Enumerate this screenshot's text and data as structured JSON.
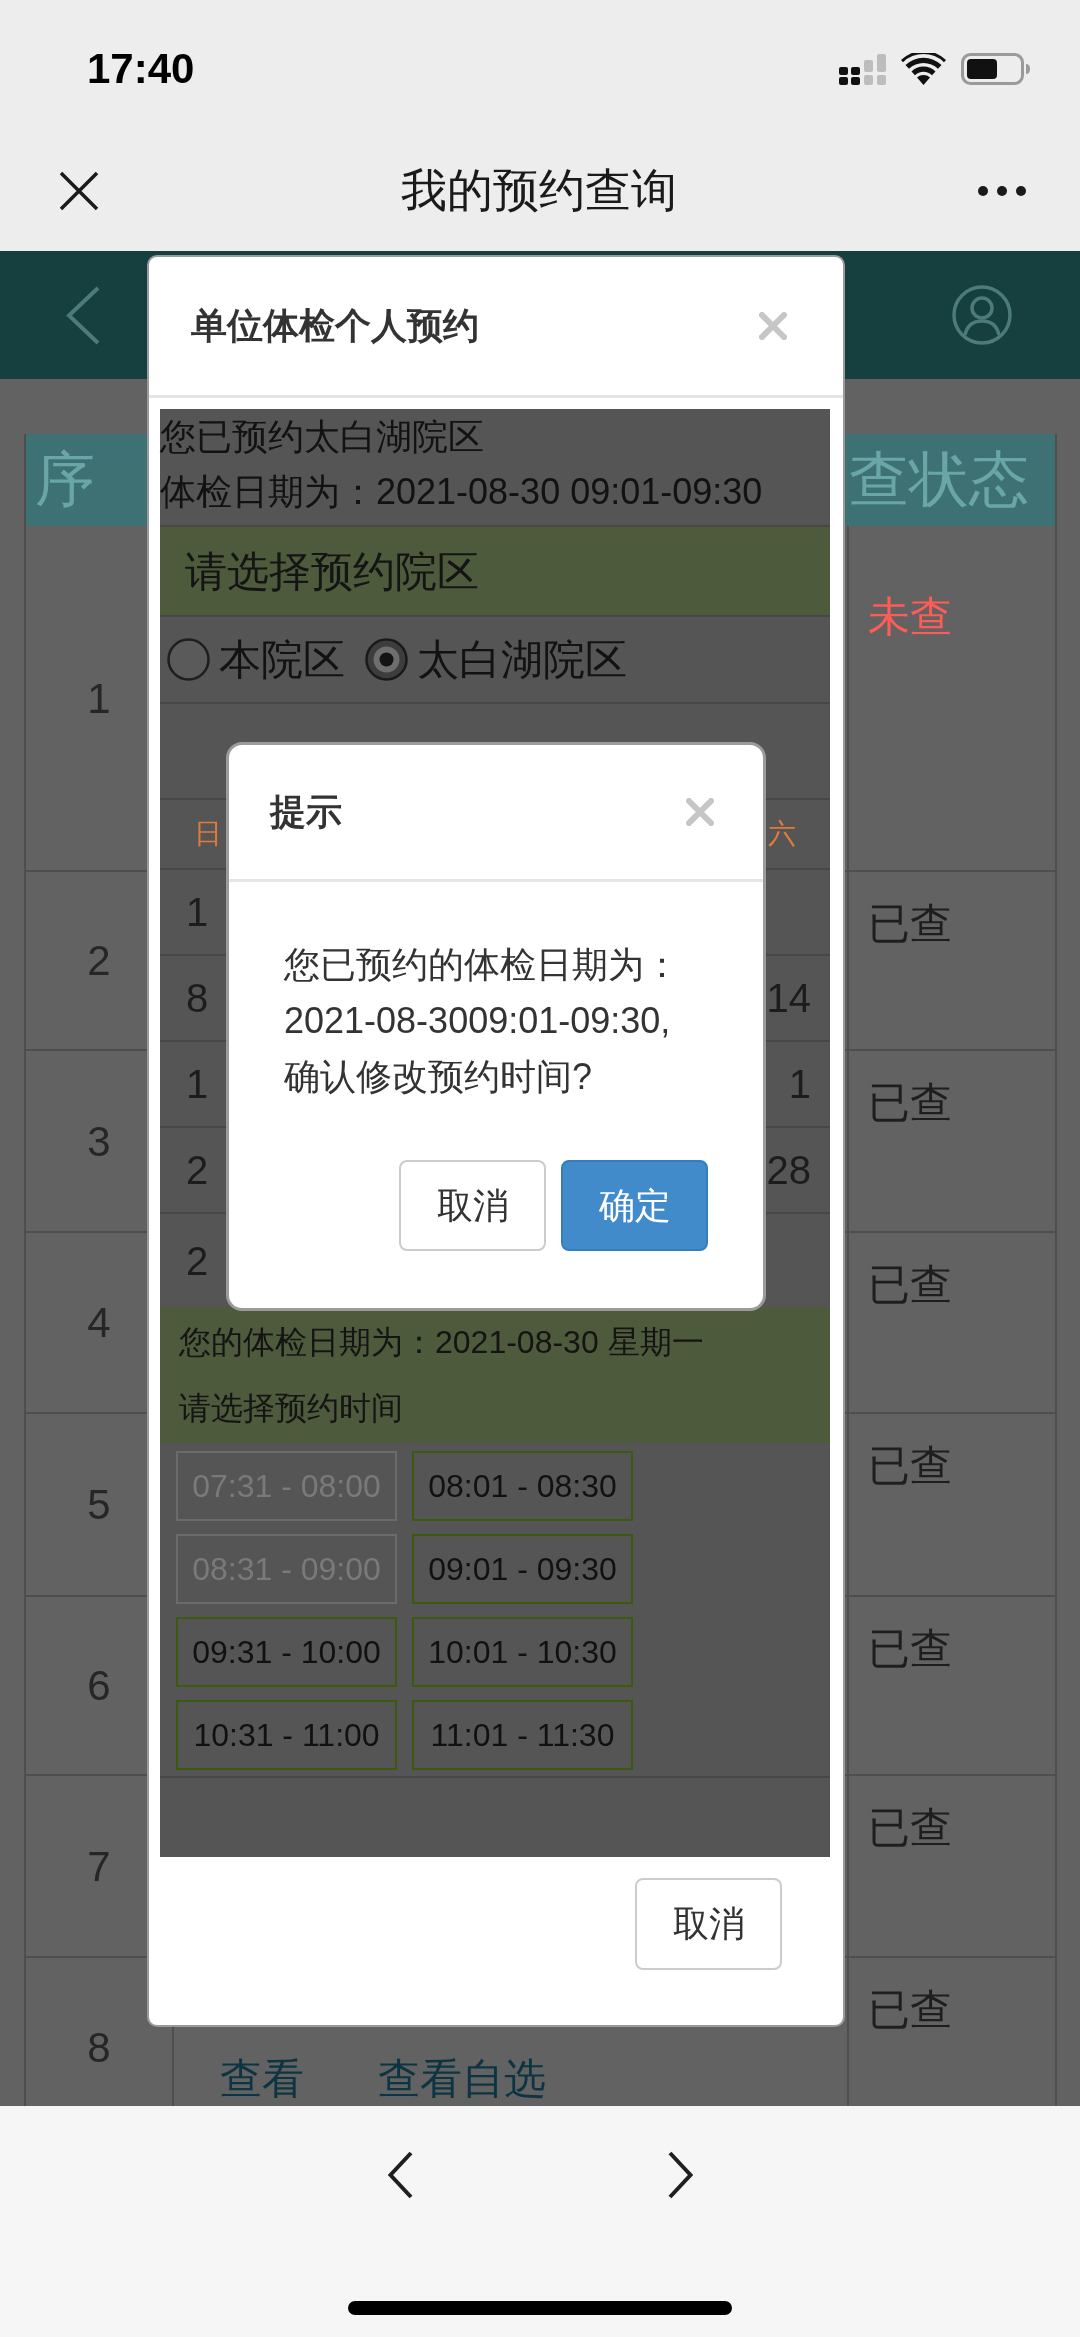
{
  "status_bar": {
    "time": "17:40"
  },
  "nav_bar": {
    "title": "我的预约查询"
  },
  "table": {
    "columns": [
      {
        "label": "序"
      },
      {
        "label": "查状态"
      }
    ],
    "rows": [
      {
        "number": "1",
        "status": "未查",
        "checked": false
      },
      {
        "number": "2",
        "status": "已查",
        "checked": true
      },
      {
        "number": "3",
        "status": "已查",
        "checked": true
      },
      {
        "number": "4",
        "status": "已查",
        "checked": true
      },
      {
        "number": "5",
        "status": "已查",
        "checked": true
      },
      {
        "number": "6",
        "status": "已查",
        "checked": true
      },
      {
        "number": "7",
        "status": "已查",
        "checked": true
      },
      {
        "number": "8",
        "status": "已查",
        "checked": true,
        "links": [
          "查看",
          "查看自选"
        ]
      }
    ]
  },
  "booking_dialog": {
    "title": "单位体检个人预约",
    "booked_campus": "您已预约太白湖院区",
    "booked_date": "体检日期为：2021-08-30 09:01-09:30",
    "campus_prompt": "请选择预约院区",
    "campuses": [
      {
        "label": "本院区",
        "selected": false
      },
      {
        "label": "太白湖院区",
        "selected": true
      }
    ],
    "calendar": {
      "weekdays": {
        "sunday": "日",
        "saturday": "六"
      },
      "weeks": [
        {
          "sunday": "1"
        },
        {
          "sunday": "8",
          "saturday": "14"
        },
        {
          "sunday": "1",
          "saturday": "1"
        },
        {
          "sunday": "2",
          "saturday": "28"
        },
        {
          "sunday": "2"
        }
      ]
    },
    "selected_date": "您的体检日期为：2021-08-30 星期一",
    "time_prompt": "请选择预约时间",
    "time_slots": [
      {
        "label": "07:31 - 08:00",
        "disabled": true
      },
      {
        "label": "08:01 - 08:30",
        "disabled": false
      },
      {
        "label": "08:31 - 09:00",
        "disabled": true
      },
      {
        "label": "09:01 - 09:30",
        "disabled": false
      },
      {
        "label": "09:31 - 10:00",
        "disabled": false
      },
      {
        "label": "10:01 - 10:30",
        "disabled": false
      },
      {
        "label": "10:31 - 11:00",
        "disabled": false
      },
      {
        "label": "11:01 - 11:30",
        "disabled": false
      }
    ],
    "cancel_button": "取消"
  },
  "confirm_dialog": {
    "title": "提示",
    "message": "您已预约的体检日期为：2021-08-3009:01-09:30,确认修改预约时间?",
    "buttons": [
      {
        "label": "取消",
        "kind": "default"
      },
      {
        "label": "确定",
        "kind": "primary"
      }
    ]
  }
}
